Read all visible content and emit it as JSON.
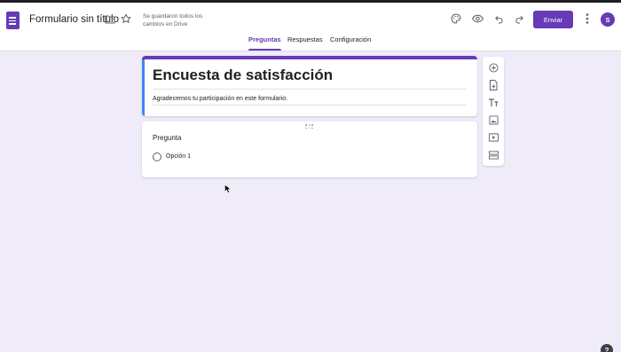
{
  "header": {
    "doc_title": "Formulario sin título",
    "save_status": "Se guardaron todos los cambios en Drive",
    "send_label": "Enviar",
    "avatar_initial": "S",
    "icons": [
      "forms-logo-icon",
      "folder-icon",
      "star-icon",
      "palette-icon",
      "eye-icon",
      "undo-icon",
      "redo-icon",
      "more-vert-icon"
    ]
  },
  "tabs": [
    {
      "label": "Preguntas",
      "active": true
    },
    {
      "label": "Respuestas",
      "active": false
    },
    {
      "label": "Configuración",
      "active": false
    }
  ],
  "form": {
    "title": "Encuesta de satisfacción",
    "description": "Agradecemos tu participación en este formulario."
  },
  "question": {
    "label": "Pregunta",
    "options": [
      "Opción 1"
    ]
  },
  "side_toolbar": {
    "icons": [
      "add-question-icon",
      "import-questions-icon",
      "add-title-icon",
      "add-image-icon",
      "add-video-icon",
      "add-section-icon"
    ]
  },
  "help": {
    "label": "?"
  },
  "colors": {
    "accent": "#673ab7",
    "background": "#f0ebf8",
    "title_card_left_border": "#4285f4"
  }
}
